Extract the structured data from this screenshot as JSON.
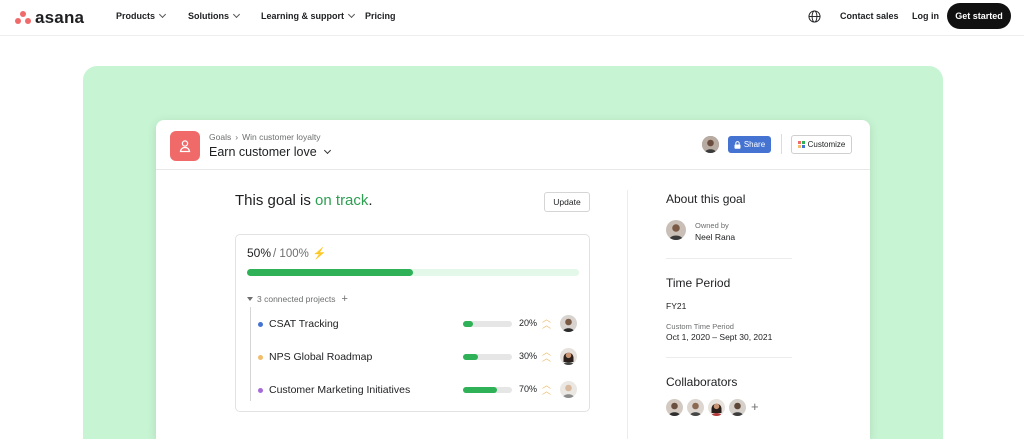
{
  "nav": {
    "logo_text": "asana",
    "items": [
      "Products",
      "Solutions",
      "Learning & support",
      "Pricing"
    ],
    "contact_sales": "Contact sales",
    "log_in": "Log in",
    "get_started": "Get started"
  },
  "colors": {
    "brand_coral": "#f06a6a",
    "hero_green": "#c7f5d3",
    "progress_green": "#2eb157",
    "on_track_green": "#2e9e52",
    "share_blue": "#4573d2"
  },
  "card": {
    "breadcrumb": [
      "Goals",
      "Win customer loyalty"
    ],
    "title": "Earn customer love",
    "share_label": "Share",
    "customize_label": "Customize"
  },
  "goal": {
    "status_prefix": "This goal is ",
    "status_value": "on track",
    "status_suffix": ".",
    "update_label": "Update",
    "progress": "50%",
    "target": "/ 100%",
    "progress_fraction": 0.5,
    "connected_label": "3 connected projects",
    "projects": [
      {
        "name": "CSAT Tracking",
        "pct": "20%",
        "fraction": 0.2,
        "dot": "#4573d2"
      },
      {
        "name": "NPS Global Roadmap",
        "pct": "30%",
        "fraction": 0.3,
        "dot": "#f1bd6c"
      },
      {
        "name": "Customer Marketing Initiatives",
        "pct": "70%",
        "fraction": 0.7,
        "dot": "#a66bd6"
      }
    ]
  },
  "about": {
    "heading": "About this goal",
    "owned_by_label": "Owned by",
    "owner": "Neel Rana",
    "time_heading": "Time Period",
    "period": "FY21",
    "custom_label": "Custom Time Period",
    "custom_range": "Oct 1, 2020 – Sept 30, 2021",
    "collab_heading": "Collaborators"
  }
}
